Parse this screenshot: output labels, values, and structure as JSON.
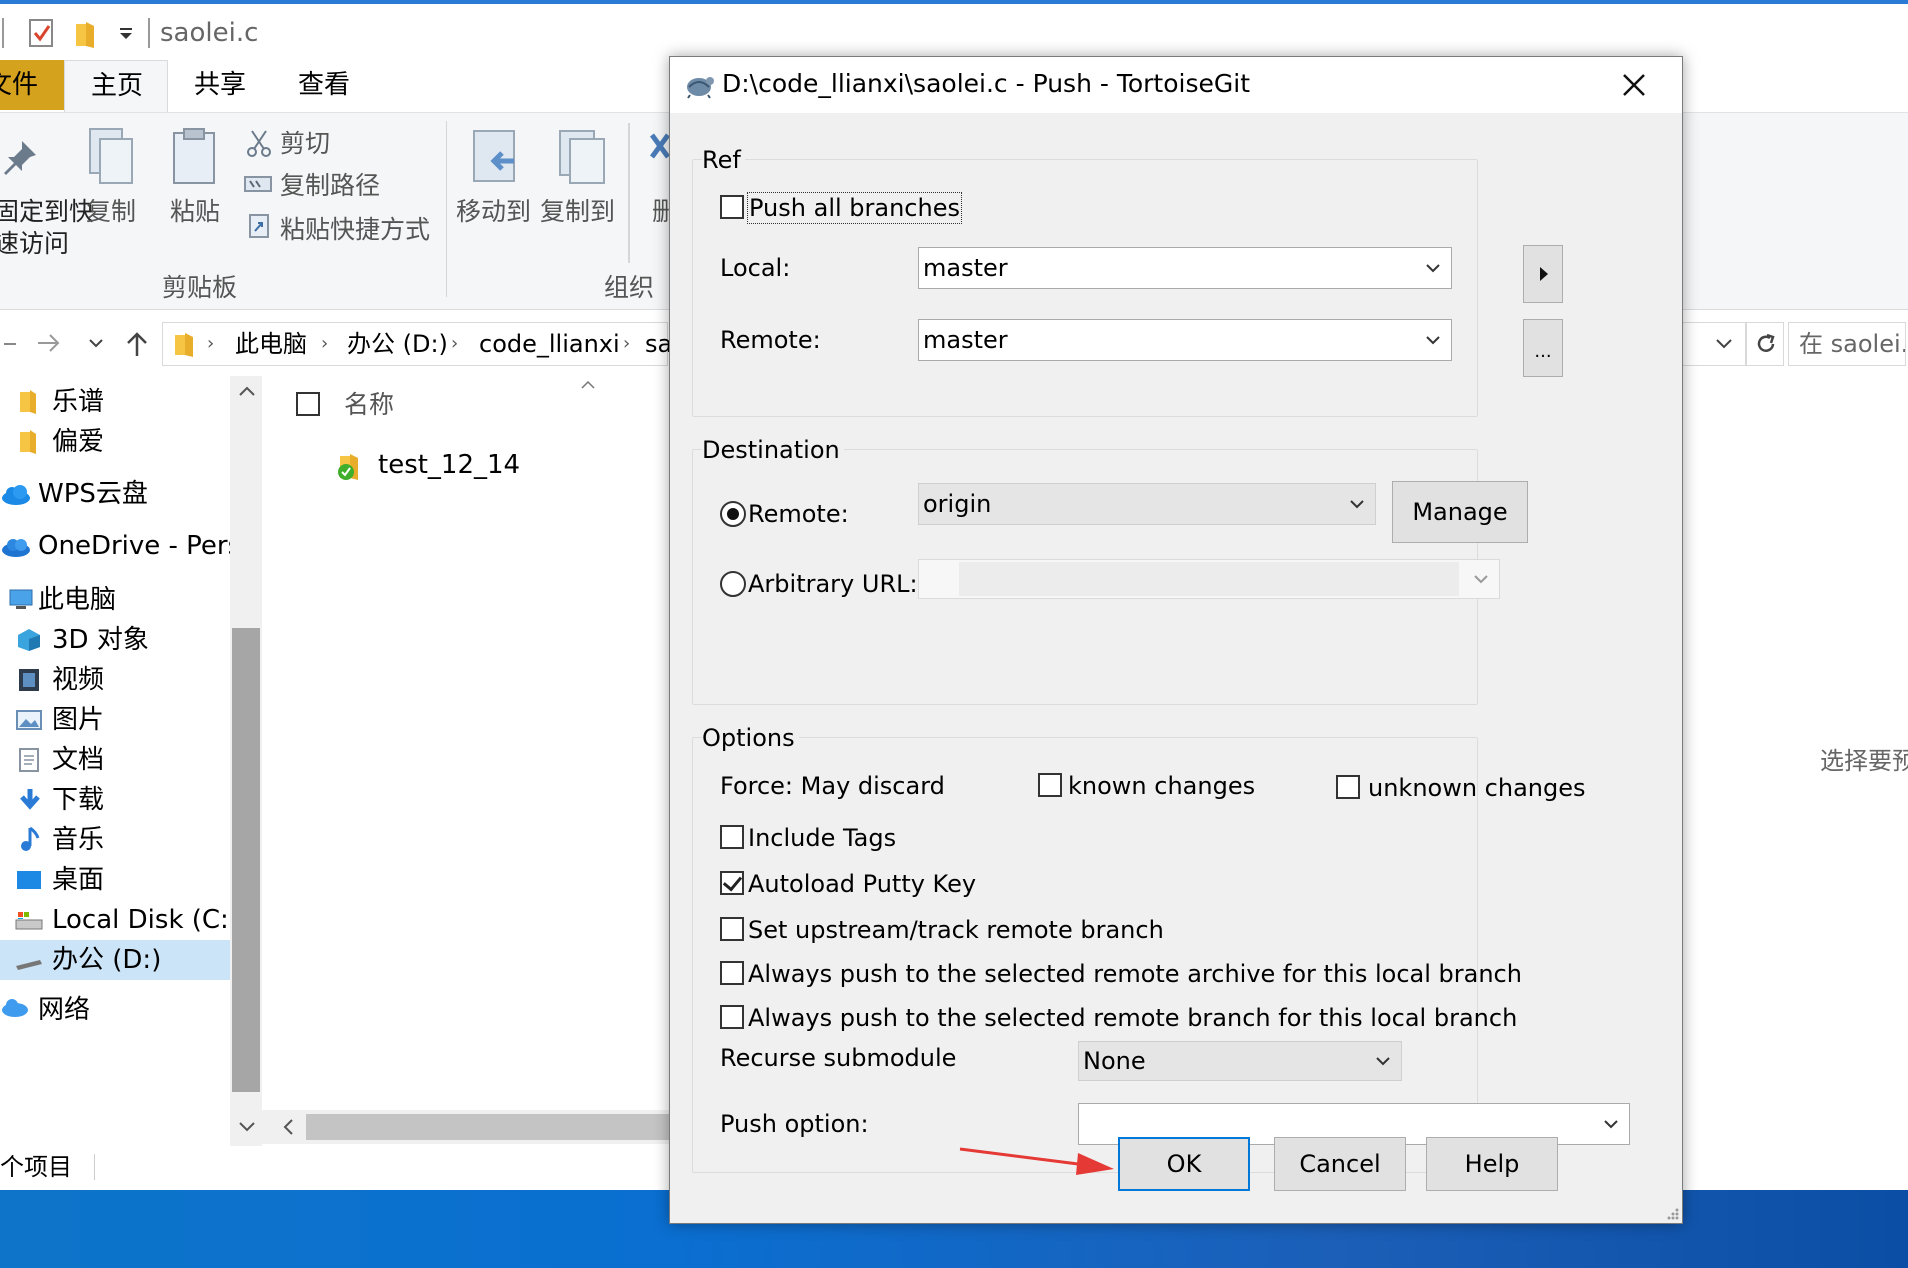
{
  "explorer": {
    "title": "saolei.c",
    "tabs": {
      "file": "文件",
      "home": "主页",
      "share": "共享",
      "view": "查看"
    },
    "ribbon": {
      "pin_line1": "固定到快",
      "pin_line2": "速访问",
      "copy": "复制",
      "paste": "粘贴",
      "cut": "剪切",
      "copy_path": "复制路径",
      "paste_shortcut": "粘贴快捷方式",
      "clipboard_group": "剪贴板",
      "move_to": "移动到",
      "copy_to": "复制到",
      "delete": "删",
      "organize_group": "组织"
    },
    "breadcrumb": {
      "items": [
        "此电脑",
        "办公 (D:)",
        "code_llianxi",
        "sa"
      ]
    },
    "search_placeholder": "在 saolei.c",
    "nav": {
      "items": [
        {
          "label": "乐谱"
        },
        {
          "label": "偏爱"
        },
        {
          "label": "WPS云盘"
        },
        {
          "label": "OneDrive - Persc"
        },
        {
          "label": "此电脑"
        },
        {
          "label": "3D 对象"
        },
        {
          "label": "视频"
        },
        {
          "label": "图片"
        },
        {
          "label": "文档"
        },
        {
          "label": "下载"
        },
        {
          "label": "音乐"
        },
        {
          "label": "桌面"
        },
        {
          "label": "Local Disk (C:)"
        },
        {
          "label": "办公 (D:)"
        },
        {
          "label": "网络"
        }
      ]
    },
    "list": {
      "column_name": "名称",
      "files": [
        "test_12_14"
      ]
    },
    "status": "个项目",
    "preview_hint": "选择要预"
  },
  "dialog": {
    "title": "D:\\code_llianxi\\saolei.c - Push - TortoiseGit",
    "ref": {
      "group_label": "Ref",
      "push_all_branches": "Push all branches",
      "push_all_checked": false,
      "local_label": "Local:",
      "local_value": "master",
      "remote_label": "Remote:",
      "remote_value": "master",
      "ellipsis": "..."
    },
    "destination": {
      "group_label": "Destination",
      "remote_label": "Remote:",
      "remote_value": "origin",
      "manage": "Manage",
      "arbitrary_url_label": "Arbitrary URL:",
      "selected": "remote"
    },
    "options": {
      "group_label": "Options",
      "force_label": "Force: May discard",
      "known_changes": "known changes",
      "unknown_changes": "unknown changes",
      "include_tags": "Include Tags",
      "autoload_putty": "Autoload Putty Key",
      "autoload_checked": true,
      "set_upstream": "Set upstream/track remote branch",
      "always_archive": "Always push to the selected remote archive for this local branch",
      "always_branch": "Always push to the selected remote branch for this local branch",
      "recurse_label": "Recurse submodule",
      "recurse_value": "None",
      "push_option_label": "Push option:",
      "push_option_value": ""
    },
    "buttons": {
      "ok": "OK",
      "cancel": "Cancel",
      "help": "Help"
    }
  },
  "colors": {
    "accent": "#0078d7",
    "file_tab": "#d4a21c",
    "arrow": "#e53935",
    "taskbar": "#0a6fd1"
  }
}
